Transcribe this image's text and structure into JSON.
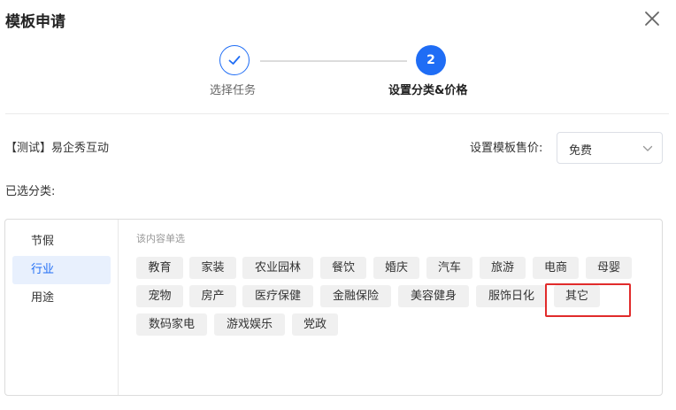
{
  "dialog": {
    "title": "模板申请",
    "close_icon": "close-icon"
  },
  "steps": [
    {
      "label": "选择任务",
      "state": "completed",
      "icon": "check-icon"
    },
    {
      "label": "设置分类&价格",
      "number": "2",
      "state": "active"
    }
  ],
  "template_name": "【测试】易企秀互动",
  "price": {
    "label": "设置模板售价:",
    "value": "免费",
    "icon": "chevron-down-icon"
  },
  "selected_label": "已选分类:",
  "category_groups": [
    {
      "label": "节假",
      "active": false
    },
    {
      "label": "行业",
      "active": true
    },
    {
      "label": "用途",
      "active": false
    }
  ],
  "hint": "该内容单选",
  "tags": [
    "教育",
    "家装",
    "农业园林",
    "餐饮",
    "婚庆",
    "汽车",
    "旅游",
    "电商",
    "母婴",
    "宠物",
    "房产",
    "医疗保健",
    "金融保险",
    "美容健身",
    "服饰日化",
    "其它",
    "数码家电",
    "游戏娱乐",
    "党政"
  ],
  "colors": {
    "accent": "#1f6df5",
    "highlight": "#e12b2b",
    "tag_bg": "#f0f0f0"
  }
}
